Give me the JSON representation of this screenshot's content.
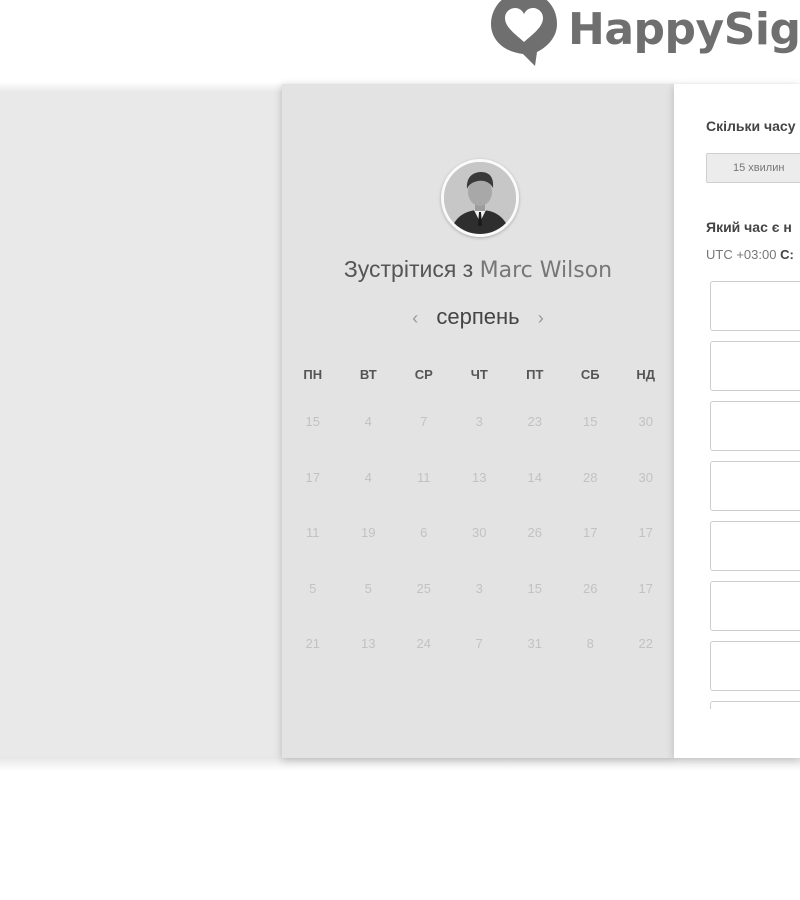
{
  "header": {
    "logo_text": "HappySign",
    "logo_icon": "heart-speech-bubble-icon"
  },
  "calendar": {
    "meet_prefix": "Зустрітися з",
    "host_name": "Marc Wilson",
    "month": "серпень",
    "prev_icon": "chevron-left-icon",
    "next_icon": "chevron-right-icon",
    "weekdays": [
      "ПН",
      "ВТ",
      "СР",
      "ЧТ",
      "ПТ",
      "СБ",
      "НД"
    ],
    "weeks": [
      [
        "15",
        "4",
        "7",
        "3",
        "23",
        "15",
        "30"
      ],
      [
        "17",
        "4",
        "11",
        "13",
        "14",
        "28",
        "30"
      ],
      [
        "11",
        "19",
        "6",
        "30",
        "26",
        "17",
        "17"
      ],
      [
        "5",
        "5",
        "25",
        "3",
        "15",
        "26",
        "17"
      ],
      [
        "21",
        "13",
        "24",
        "7",
        "31",
        "8",
        "22"
      ]
    ]
  },
  "booking": {
    "duration_question": "Скільки часу",
    "duration_option": "15 хвилин",
    "time_question": "Який час є н",
    "timezone_prefix": "UTC +03:00",
    "timezone_city": "C:"
  },
  "colors": {
    "calendar_panel": "#e3e3e3",
    "background_band": "#e9e9e9",
    "logo": "#6f6f6f"
  }
}
